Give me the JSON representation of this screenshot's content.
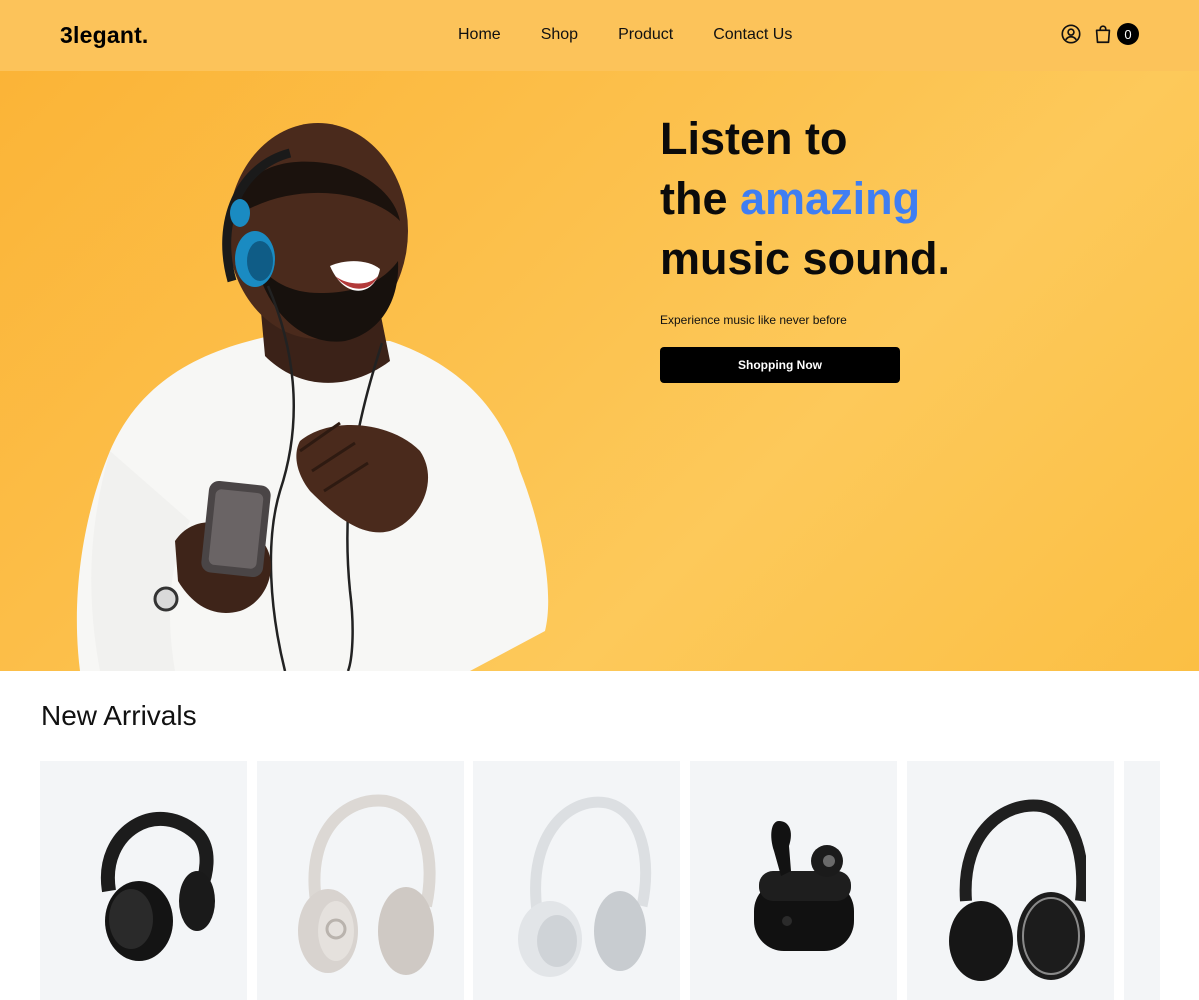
{
  "header": {
    "logo": "3legant.",
    "nav": [
      "Home",
      "Shop",
      "Product",
      "Contact Us"
    ],
    "icons": [
      "user-circle-icon",
      "shopping-bag-icon"
    ],
    "cart_count": "0"
  },
  "hero": {
    "title_line1": "Listen to",
    "title_line2_prefix": "the ",
    "title_line2_accent": "amazing",
    "title_line3": "music sound.",
    "subtitle": "Experience music like never before",
    "cta_label": "Shopping Now",
    "accent_color": "#3f7ef2",
    "background_color": "#fcc35a"
  },
  "new_arrivals": {
    "title": "New Arrivals",
    "products": [
      {
        "image": "black-over-ear-headphones"
      },
      {
        "image": "white-beats-headphones"
      },
      {
        "image": "light-gray-sony-headphones"
      },
      {
        "image": "black-earbuds-with-case"
      },
      {
        "image": "black-akg-headphones"
      },
      {
        "image": "partial-card"
      }
    ]
  }
}
